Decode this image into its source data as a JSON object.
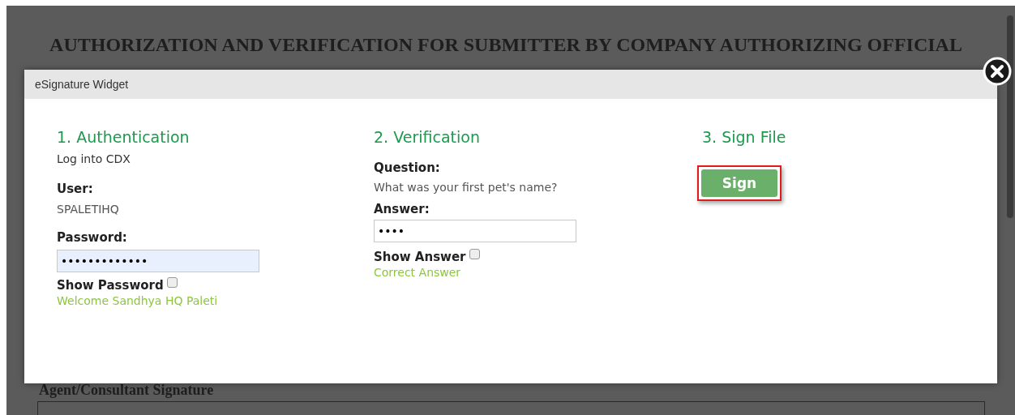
{
  "document": {
    "title": "AUTHORIZATION AND VERIFICATION FOR SUBMITTER BY COMPANY AUTHORIZING OFFICIAL",
    "section_heading": "Agent/Consultant Signature"
  },
  "dialog": {
    "title": "eSignature Widget",
    "sections": [
      {
        "kind": "auth",
        "heading": "1. Authentication",
        "subtitle": "Log into CDX",
        "user_label": "User:",
        "user_value": "SPALETIHQ",
        "field_label": "Password:",
        "field_value": "•••••••••••••",
        "toggle_label": "Show Password",
        "toggle_checked": false,
        "status": "Welcome Sandhya HQ Paleti"
      },
      {
        "kind": "verify",
        "heading": "2. Verification",
        "question_label": "Question:",
        "question": "What was your first pet's name?",
        "field_label": "Answer:",
        "field_value": "••••",
        "toggle_label": "Show Answer",
        "toggle_checked": false,
        "status": "Correct Answer"
      },
      {
        "kind": "sign",
        "heading": "3. Sign File",
        "button": "Sign"
      }
    ]
  }
}
